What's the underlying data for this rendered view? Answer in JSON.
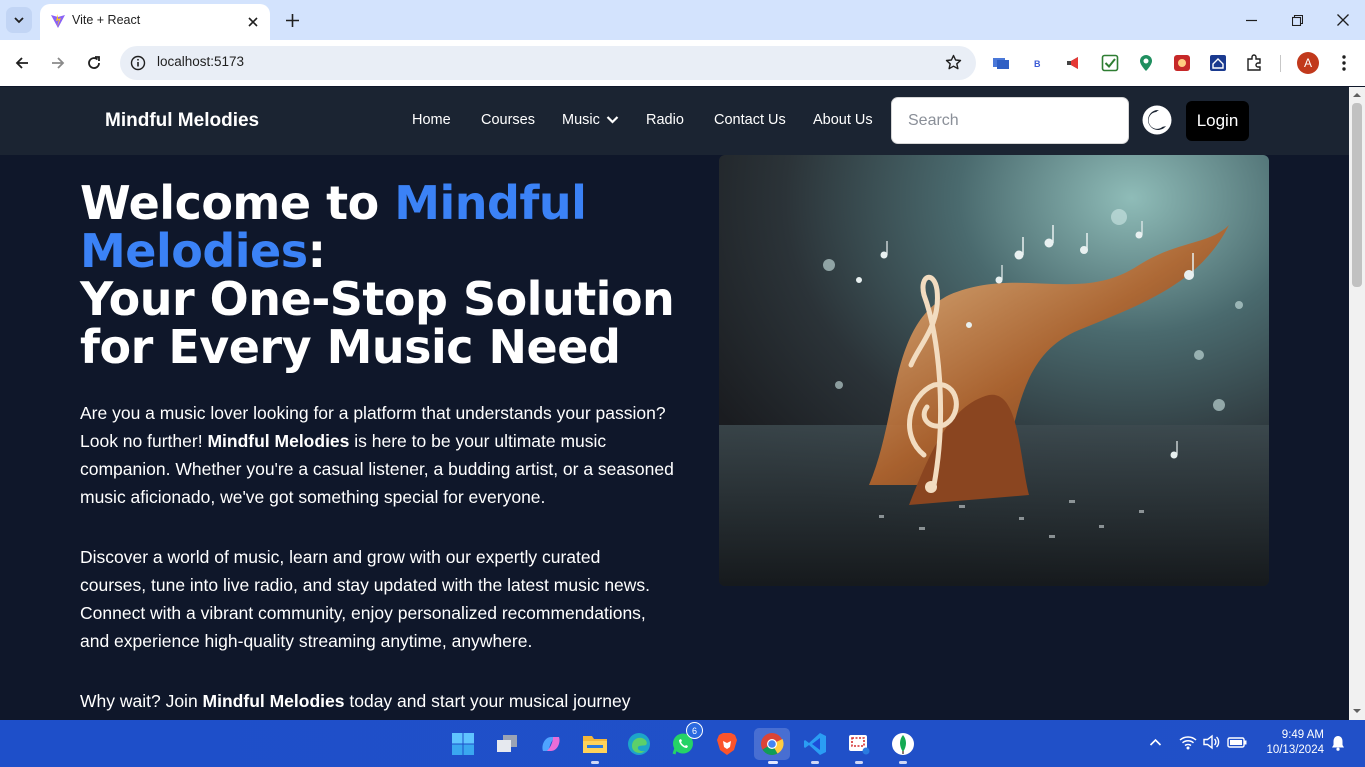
{
  "browser": {
    "tab_title": "Vite + React",
    "url": "localhost:5173",
    "profile_initial": "A"
  },
  "site": {
    "brand": "Mindful Melodies",
    "nav": {
      "home": "Home",
      "courses": "Courses",
      "music": "Music",
      "radio": "Radio",
      "contact": "Contact Us",
      "about": "About Us"
    },
    "search_placeholder": "Search",
    "login_label": "Login"
  },
  "hero": {
    "title_prefix": "Welcome to ",
    "title_brand": "Mindful Melodies",
    "title_colon": ":",
    "title_line2": "Your One-Stop Solution for Every Music Need",
    "p1_before": "Are you a music lover looking for a platform that understands your passion? Look no further! ",
    "p1_bold": "Mindful Melodies",
    "p1_after": " is here to be your ultimate music companion. Whether you're a casual listener, a budding artist, or a seasoned music aficionado, we've got something special for everyone.",
    "p2": "Discover a world of music, learn and grow with our expertly curated courses, tune into live radio, and stay updated with the latest music news. Connect with a vibrant community, enjoy personalized recommendations, and experience high-quality streaming anytime, anywhere.",
    "p3_before": "Why wait? Join ",
    "p3_bold": "Mindful Melodies",
    "p3_after": " today and start your musical journey"
  },
  "taskbar": {
    "whatsapp_badge": "6",
    "time": "9:49 AM",
    "date": "10/13/2024"
  },
  "colors": {
    "accent": "#3b82f6",
    "page_bg": "#0f172a",
    "nav_bg": "#1b2432",
    "taskbar": "#1e4fc9"
  }
}
